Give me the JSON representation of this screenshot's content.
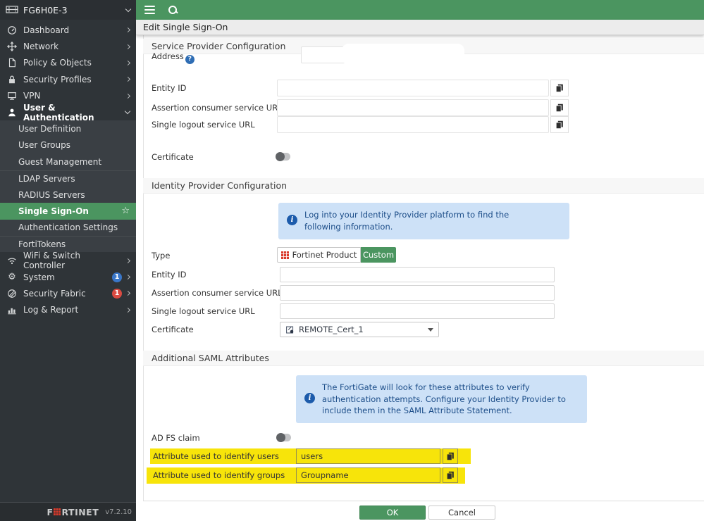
{
  "device": {
    "hostname": "FG6H0E-3",
    "firmware_version": "v7.2.10",
    "brand_f": "F",
    "brand_rest": "RTINET"
  },
  "titlebar": {
    "title": "Edit Single Sign-On"
  },
  "icons": {
    "help_glyph": "?",
    "info_glyph": "i",
    "star_glyph": "☆",
    "gear_glyph": "⚙"
  },
  "sidebar": {
    "menu": [
      {
        "label": "Dashboard",
        "icon": "dashboard-icon"
      },
      {
        "label": "Network",
        "icon": "network-icon"
      },
      {
        "label": "Policy & Objects",
        "icon": "policy-objects-icon"
      },
      {
        "label": "Security Profiles",
        "icon": "security-profiles-icon"
      },
      {
        "label": "VPN",
        "icon": "vpn-icon"
      },
      {
        "label": "User & Authentication",
        "icon": "user-authentication-icon",
        "expanded": true
      },
      {
        "label": "User Definition",
        "submenu": true
      },
      {
        "label": "User Groups",
        "submenu": true
      },
      {
        "label": "Guest Management",
        "submenu": true
      },
      {
        "label": "LDAP Servers",
        "submenu": true
      },
      {
        "label": "RADIUS Servers",
        "submenu": true
      },
      {
        "label": "Single Sign-On",
        "submenu": true,
        "selected": true
      },
      {
        "label": "Authentication Settings",
        "submenu": true
      },
      {
        "label": "FortiTokens",
        "submenu": true
      },
      {
        "label": "WiFi & Switch Controller",
        "icon": "wifi-switch-icon"
      },
      {
        "label": "System",
        "icon": "system-gear-icon",
        "badge": "1",
        "badge_color": "#3a77c9"
      },
      {
        "label": "Security Fabric",
        "icon": "security-fabric-icon",
        "badge": "1",
        "badge_color": "#da4b42"
      },
      {
        "label": "Log & Report",
        "icon": "log-report-icon"
      }
    ]
  },
  "service_provider": {
    "section_title": "Service Provider Configuration",
    "address_label": "Address",
    "entity_id_label": "Entity ID",
    "acs_url_label": "Assertion consumer service URL",
    "slo_url_label": "Single logout service URL",
    "certificate_label": "Certificate"
  },
  "identity_provider": {
    "section_title": "Identity Provider Configuration",
    "info_text": "Log into your Identity Provider platform to find the following information.",
    "type_label": "Type",
    "type_option_fortinet": "Fortinet Product",
    "type_option_custom": "Custom",
    "type_selected": "Custom",
    "entity_id_label": "Entity ID",
    "acs_url_label": "Assertion consumer service URL",
    "slo_url_label": "Single logout service URL",
    "certificate_label": "Certificate",
    "certificate_value": "REMOTE_Cert_1"
  },
  "saml_attributes": {
    "section_title": "Additional SAML Attributes",
    "info_text": "The FortiGate will look for these attributes to verify authentication attempts. Configure your Identity Provider to include them in the SAML Attribute Statement.",
    "adfs_claim_label": "AD FS claim",
    "user_attr_label": "Attribute used to identify users",
    "user_attr_value": "users",
    "group_attr_label": "Attribute used to identify groups",
    "group_attr_value": "Groupname"
  },
  "actions": {
    "ok": "OK",
    "cancel": "Cancel"
  },
  "colors": {
    "accent_green": "#4b9560",
    "sidebar_bg": "#2f3438",
    "highlight_yellow": "#f7e40a",
    "info_bg": "#cde1f7",
    "badge_blue": "#3a77c9",
    "badge_red": "#da4b42"
  }
}
